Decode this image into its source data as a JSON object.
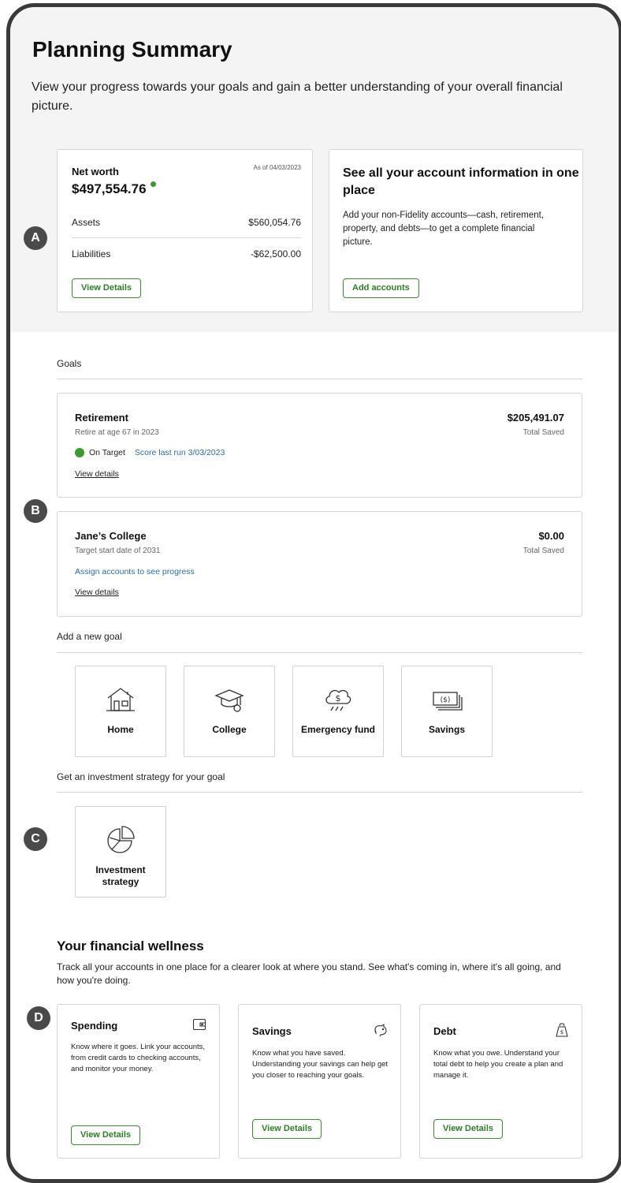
{
  "header": {
    "title": "Planning Summary",
    "intro": "View your progress towards your goals and gain a better understanding of your overall financial picture."
  },
  "net_worth": {
    "title": "Net worth",
    "as_of": "As of 04/03/2023",
    "value": "$497,554.76",
    "assets_label": "Assets",
    "assets_value": "$560,054.76",
    "liabilities_label": "Liabilities",
    "liabilities_value": "-$62,500.00",
    "button": "View Details"
  },
  "accounts_promo": {
    "title": "See all your account information in one place",
    "description": "Add your non-Fidelity accounts—cash, retirement, property, and debts—to get a complete financial picture.",
    "button": "Add accounts"
  },
  "markers": {
    "a": "A",
    "b": "B",
    "c": "C",
    "d": "D"
  },
  "goals": {
    "section_label": "Goals",
    "items": [
      {
        "name": "Retirement",
        "subtitle": "Retire at age 67 in 2023",
        "amount": "$205,491.07",
        "amount_label": "Total Saved",
        "status": "On Target",
        "score_link": "Score last run 3/03/2023",
        "details_link": "View details"
      },
      {
        "name": "Jane’s College",
        "subtitle": "Target start date of 2031",
        "amount": "$0.00",
        "amount_label": "Total Saved",
        "assign_link": "Assign accounts to see progress",
        "details_link": "View details"
      }
    ]
  },
  "new_goal": {
    "section_label": "Add a new goal",
    "tiles": [
      {
        "label": "Home",
        "icon": "house-icon"
      },
      {
        "label": "College",
        "icon": "graduation-cap-icon"
      },
      {
        "label": "Emergency fund",
        "icon": "cloud-dollar-icon"
      },
      {
        "label": "Savings",
        "icon": "cash-stack-icon"
      }
    ]
  },
  "strategy": {
    "section_label": "Get an investment strategy for your goal",
    "tile": {
      "label": "Investment strategy",
      "icon": "pie-chart-icon"
    }
  },
  "wellness": {
    "title": "Your financial wellness",
    "description": "Track all your accounts in one place for a clearer look at where you stand. See what's coming in, where it's all going, and how you're doing.",
    "cards": [
      {
        "title": "Spending",
        "icon": "wallet-icon",
        "description": "Know where it goes. Link your accounts, from credit cards to checking accounts, and monitor your money.",
        "button": "View Details"
      },
      {
        "title": "Savings",
        "icon": "piggy-bank-icon",
        "description": "Know what you have saved. Understanding your savings can help get you closer to reaching your goals.",
        "button": "View Details"
      },
      {
        "title": "Debt",
        "icon": "money-bag-icon",
        "description": "Know what you owe. Understand your total debt to help you create a plan and manage it.",
        "button": "View Details"
      }
    ]
  },
  "colors": {
    "accent_green": "#2f7d26",
    "link_blue": "#2b6e9b",
    "status_green": "#3b9b2c",
    "marker_gray": "#4a4a4a",
    "top_band": "#f4f4f4"
  }
}
